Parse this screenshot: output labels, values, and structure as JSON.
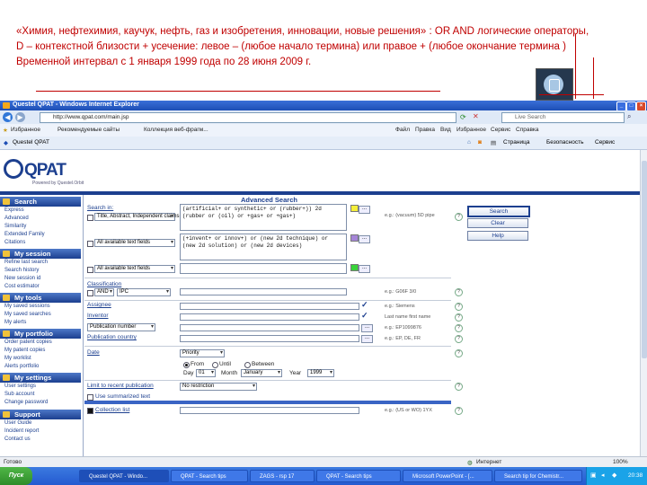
{
  "slide": {
    "line1": "«Химия, нефтехимия,  каучук, нефть, газ и  изобретения, инновации, новые решения» :  OR AND логические операторы,",
    "line2": "D – контекстной близости +  усечение: левое – (любое начало термина)  или правое + (любое  окончание термина )",
    "line3": "Временной интервал с 1 января 1999  года по 28 июня 2009 г."
  },
  "browser": {
    "title": "Questel QPAT - Windows Internet Explorer",
    "address": "http://www.qpat.com/main.jsp",
    "search_placeholder": "Live Search",
    "favorites": "Избранное",
    "fav_link1": "Рекомендуемые сайты",
    "fav_link2": "Коллекция веб-фрагм...",
    "tab_label": "Questel QPAT",
    "tools": [
      "Страница",
      "Безопасность",
      "Сервис"
    ],
    "status_text": "Готово",
    "zone": "Интернет",
    "zoom": "100%"
  },
  "menu": [
    "Файл",
    "Правка",
    "Вид",
    "Избранное",
    "Сервис",
    "Справка"
  ],
  "qpat": {
    "logo": "QPAT",
    "tagline": "Powered by Questel.Orbit"
  },
  "sidebar": {
    "search_title": "Search",
    "search_items": [
      "Express",
      "Advanced",
      "Similarity",
      "Extended Family",
      "Citations"
    ],
    "session_title": "My session",
    "session_items": [
      "Refine last search",
      "Search history",
      "New session id",
      "Cost estimator"
    ],
    "tools_title": "My tools",
    "tools_items": [
      "My saved sessions",
      "My saved searches",
      "My alerts"
    ],
    "portfolio_title": "My portfolio",
    "portfolio_items": [
      "Order patent copies",
      "My patent copies",
      "My worklist",
      "Alerts portfolio"
    ],
    "settings_title": "My settings",
    "settings_items": [
      "User settings",
      "Sub account",
      "Change password"
    ],
    "support_title": "Support",
    "support_items": [
      "User Guide",
      "Incident report",
      "Contact us"
    ]
  },
  "form": {
    "heading": "Advanced Search",
    "search_in_label": "Search in:",
    "field1_select": "Title, Abstract, Independent claims",
    "field1_text": "(artificial+ or synthetic+ or (rubber+)) 2d (rubber or (oil) or +gas+ or +gas+)",
    "field1_hint": "e.g.: (vacuum) 5D pipe",
    "field2_select": "All available text fields",
    "field2_text": "(+invent+ or innov+) or (new 2d technique) or (new 2d solution) or (new 2d devices)",
    "field3_select": "All available text fields",
    "field3_text": "",
    "classification_label": "Classification",
    "and_select": "AND",
    "ipc_select": "IPC",
    "class_hint": "e.g.: G06F 3/0",
    "assignee_label": "Assignee",
    "assignee_hint": "e.g.: Siemens",
    "inventor_label": "Inventor",
    "inventor_hint": "Last name first name",
    "pubnum_select": "Publication number",
    "pubnum_hint": "e.g.: EP1099876",
    "pubcountry_label": "Publication country",
    "pubcountry_hint": "e.g.: EP, DE, FR",
    "date_label": "Date",
    "date_type": "Priority",
    "radio_from": "From",
    "radio_until": "Until",
    "radio_between": "Between",
    "day_label": "Day",
    "day_value": "01",
    "month_label": "Month",
    "month_value": "January",
    "year_label": "Year",
    "year_value": "1999",
    "limit_label": "Limit to recent publication",
    "limit_value": "No restriction",
    "summ_label": "Use summarized text",
    "coll_label": "Collection list",
    "coll_hint": "e.g.: (US or WO) 1YX",
    "buttons": {
      "search": "Search",
      "clear": "Clear",
      "help": "Help"
    }
  },
  "taskbar": {
    "start": "Пуск",
    "tasks": [
      "Questel QPAT - Windo...",
      "QPAT - Search tips",
      "ZAGS - rsp 17",
      "QPAT - Search tips",
      "Microsoft PowerPoint - [...",
      "Search tip for Chemistr..."
    ],
    "clock": "20:38"
  },
  "colors": {
    "slide_text": "#c00000",
    "brand": "#1c3f8f",
    "titlebar": "#1d4eb5"
  }
}
